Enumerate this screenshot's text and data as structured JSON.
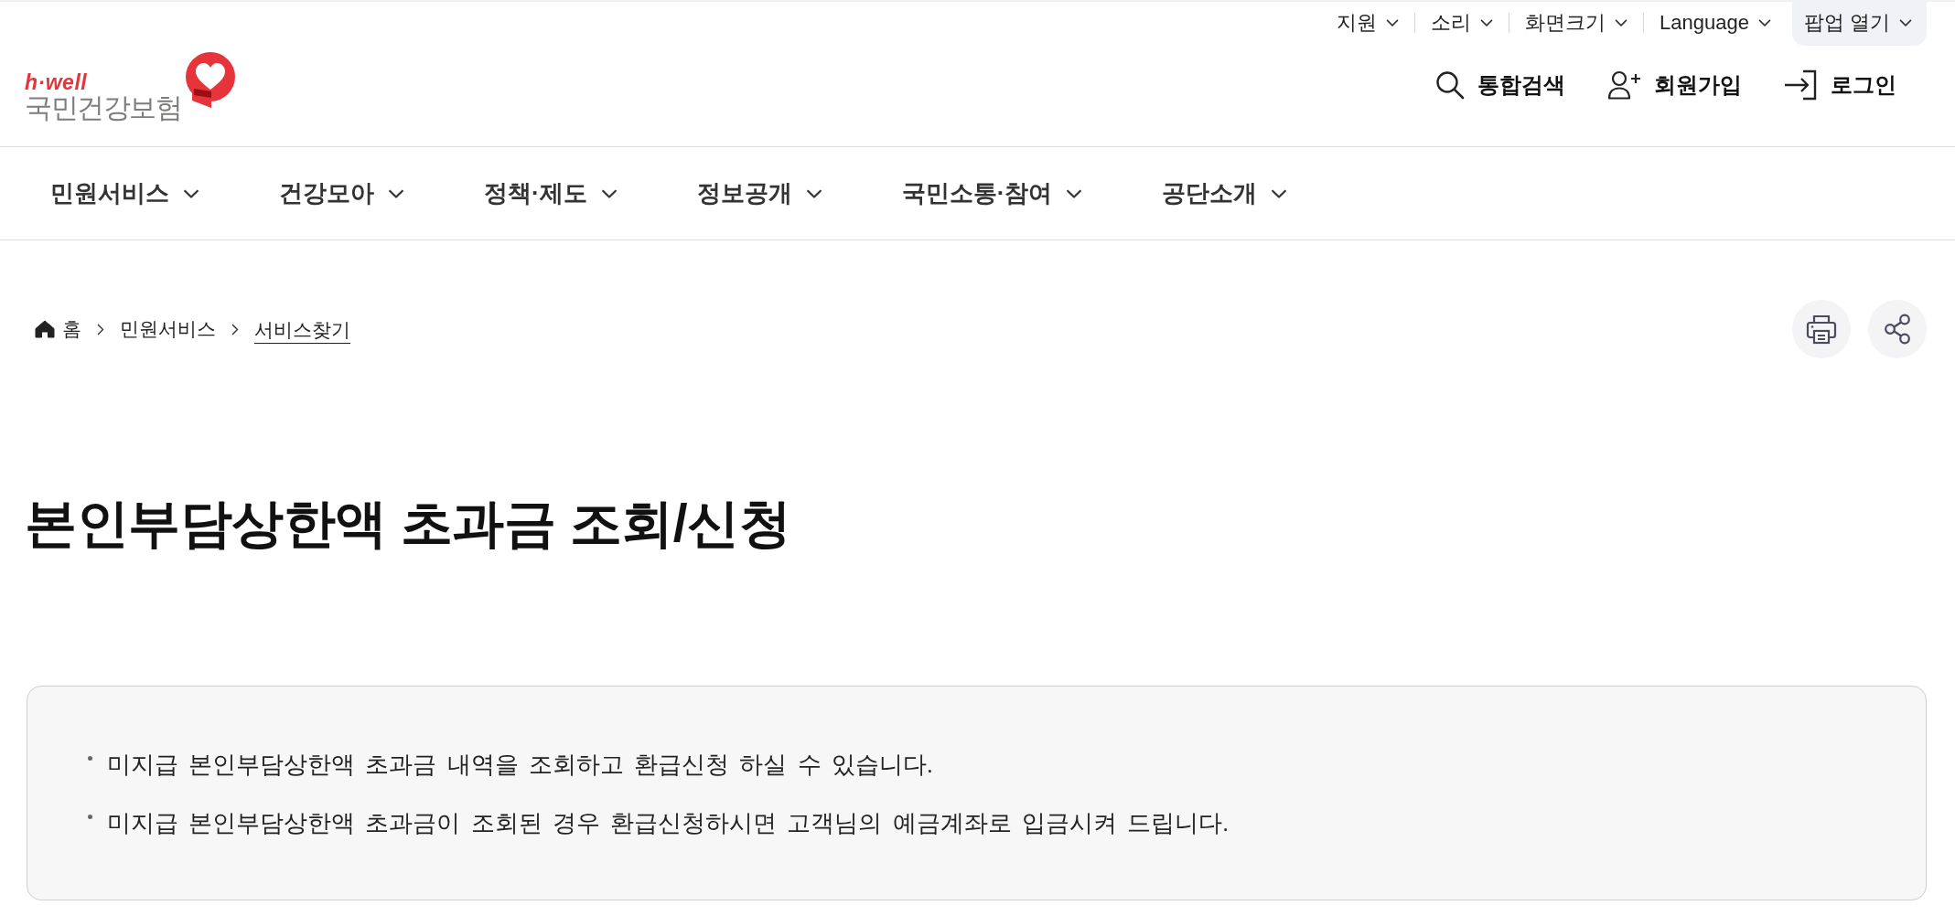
{
  "utility_bar": {
    "items": [
      {
        "label": "지원",
        "kind": "menu"
      },
      {
        "label": "소리",
        "kind": "menu"
      },
      {
        "label": "화면크기",
        "kind": "menu"
      },
      {
        "label": "Language",
        "kind": "menu"
      },
      {
        "label": "팝업 열기",
        "kind": "popup"
      }
    ]
  },
  "logo": {
    "tagline": "h·well",
    "name": "국민건강보험"
  },
  "header_actions": [
    {
      "label": "통합검색",
      "kind": "search"
    },
    {
      "label": "회원가입",
      "kind": "signup"
    },
    {
      "label": "로그인",
      "kind": "login"
    }
  ],
  "main_nav": {
    "items": [
      {
        "label": "민원서비스"
      },
      {
        "label": "건강모아"
      },
      {
        "label": "정책·제도"
      },
      {
        "label": "정보공개"
      },
      {
        "label": "국민소통·참여"
      },
      {
        "label": "공단소개"
      }
    ]
  },
  "breadcrumb": [
    {
      "label": "홈",
      "kind": "home"
    },
    {
      "label": "민원서비스",
      "kind": "link"
    },
    {
      "label": "서비스찾기",
      "kind": "current"
    }
  ],
  "page_title": "본인부담상한액 초과금 조회/신청",
  "notice": {
    "items": [
      "미지급 본인부담상한액 초과금 내역을 조회하고 환급신청 하실 수 있습니다.",
      "미지급 본인부담상한액 초과금이 조회된 경우 환급신청하시면 고객님의 예금계좌로 입금시켜 드립니다."
    ]
  }
}
